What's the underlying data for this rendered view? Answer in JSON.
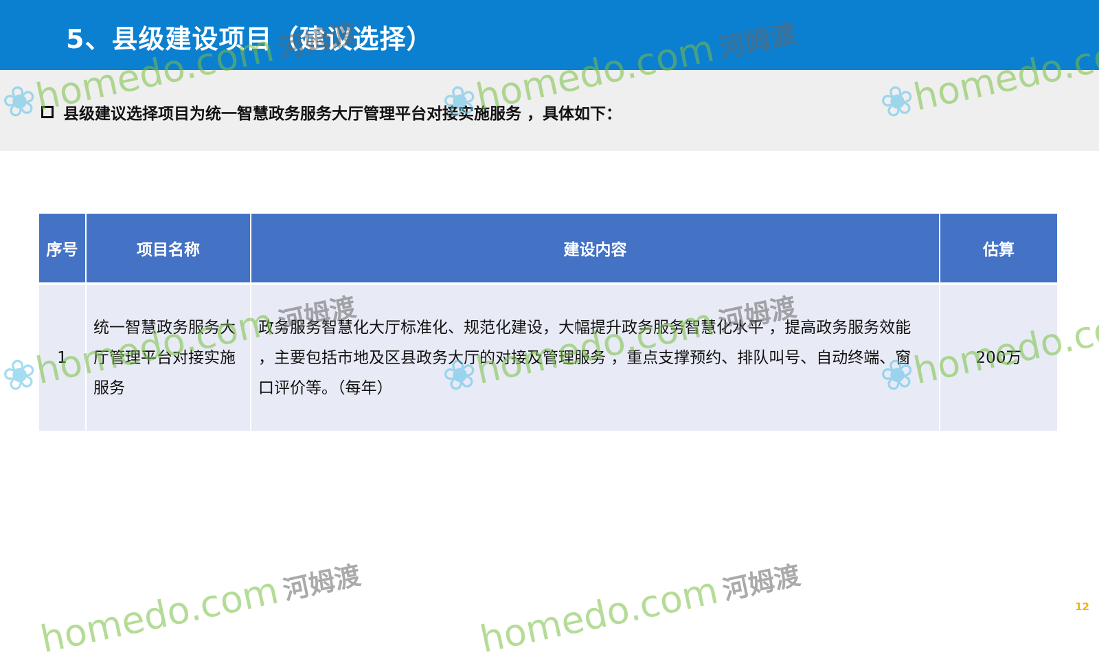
{
  "header": {
    "title": "5、县级建设项目（建议选择）"
  },
  "intro": {
    "text": "县级建议选择项目为统一智慧政务服务大厅管理平台对接实施服务 ，具体如下："
  },
  "table": {
    "headers": [
      "序号",
      "项目名称",
      "建设内容",
      "估算"
    ],
    "rows": [
      {
        "index": "1",
        "name": "统一智慧政务服务大厅管理平台对接实施服务",
        "content": "政务服务智慧化大厅标准化、规范化建设，大幅提升政务服务智慧化水平 ，提高政务服务效能 ，主要包括市地及区县政务大厅的对接及管理服务 ，重点支撑预约、排队叫号、自动终端、窗口评价等。（每年）",
        "estimate": "200万"
      }
    ]
  },
  "watermark": {
    "latin": "homedo.com",
    "cn": "河姆渡"
  },
  "page_number": "12",
  "colors": {
    "header_bg": "#0b7fd0",
    "table_header_bg": "#4472c4",
    "table_row_bg": "#e8ebf5",
    "band_bg": "#efefef",
    "page_number": "#f2b400"
  }
}
